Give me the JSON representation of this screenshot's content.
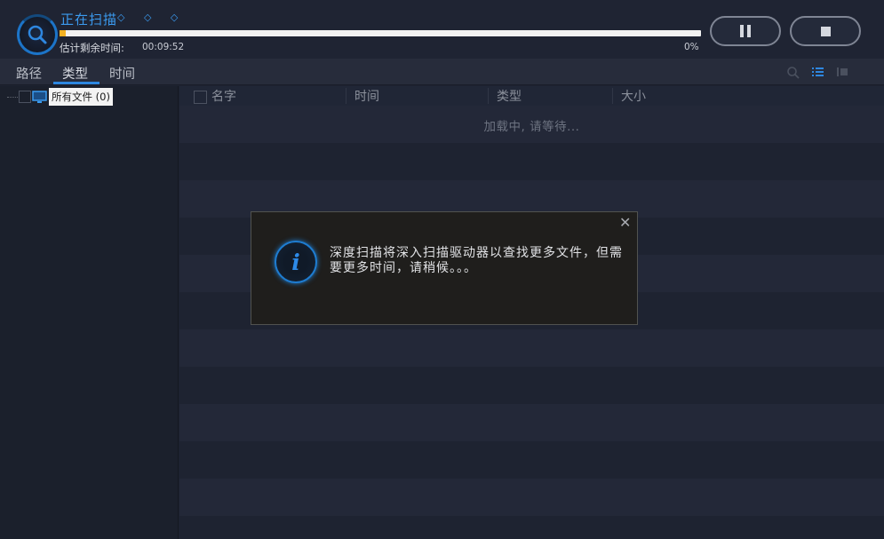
{
  "header": {
    "status_title": "正在扫描",
    "status_dots": "◇ ◇ ◇",
    "progress_percent": 0,
    "progress_text": "0%",
    "eta_label": "估计剩余时间:",
    "eta_value": "00:09:52",
    "pause_icon": "pause-icon",
    "stop_icon": "stop-icon"
  },
  "tabs": [
    {
      "label": "路径",
      "active": false
    },
    {
      "label": "类型",
      "active": true
    },
    {
      "label": "时间",
      "active": false
    }
  ],
  "toolbar": {
    "icons": [
      "search-icon",
      "list-view-icon",
      "detail-view-icon"
    ]
  },
  "tree": {
    "root_label": "所有文件 (0)",
    "root_icon": "monitor-icon"
  },
  "list": {
    "columns": [
      "名字",
      "时间",
      "类型",
      "大小"
    ],
    "loading_text": "加载中, 请等待..."
  },
  "dialog": {
    "message": "深度扫描将深入扫描驱动器以查找更多文件，但需要更多时间，请稍候。。。",
    "close_icon": "close-icon",
    "info_icon": "info-icon"
  },
  "colors": {
    "accent": "#2e87e0",
    "progress": "#f4b223",
    "background": "#1d2230"
  }
}
